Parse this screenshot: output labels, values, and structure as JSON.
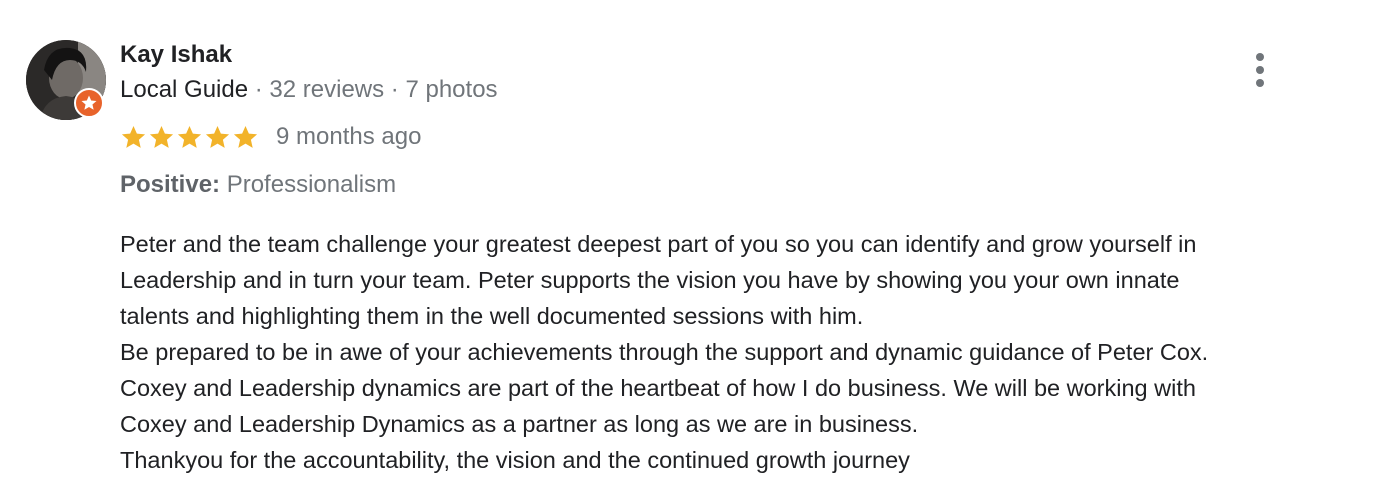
{
  "reviewer": {
    "name": "Kay Ishak",
    "guide_label": "Local Guide",
    "sep1": " · ",
    "reviews": "32 reviews",
    "sep2": " · ",
    "photos": "7 photos"
  },
  "rating": {
    "stars": 5,
    "max_stars": 5,
    "date": "9 months ago",
    "star_color": "#f2b32a"
  },
  "attributes": {
    "label": "Positive:",
    "value": "Professionalism"
  },
  "review": {
    "lines": [
      "Peter and the team challenge your greatest deepest part of you so you can identify and grow yourself in",
      "Leadership and in turn your team. Peter supports the vision you have by showing you your own innate",
      "talents and highlighting them in the well documented sessions with him.",
      "Be prepared to be in awe of your achievements through the support and dynamic guidance of Peter Cox.",
      "Coxey and Leadership dynamics are part of the heartbeat of how I do business. We will be working with",
      "Coxey and Leadership Dynamics as a partner as long as we are in business.",
      "Thankyou for the accountability, the vision and the continued growth journey"
    ]
  },
  "icons": {
    "more": "more-vert-icon",
    "badge": "local-guide-star-icon"
  },
  "colors": {
    "badge": "#e8632b",
    "text": "#202124",
    "muted": "#70757a"
  }
}
